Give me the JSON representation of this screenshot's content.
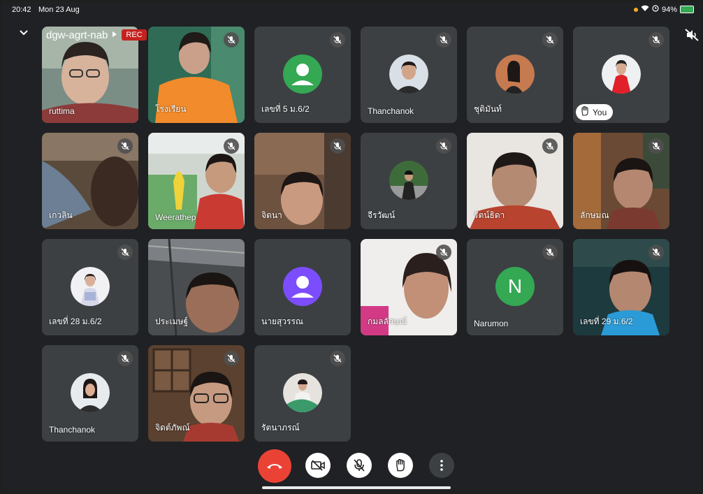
{
  "status": {
    "time": "20:42",
    "date": "Mon 23 Aug",
    "battery": "94%"
  },
  "meeting": {
    "code": "dgw-agrt-nab",
    "rec_label": "REC"
  },
  "tiles": [
    {
      "name": "ruttima"
    },
    {
      "name": "โรงเรียน"
    },
    {
      "name": "เลขที่ 5 ม.6/2"
    },
    {
      "name": "Thanchanok"
    },
    {
      "name": "ชุติมันท์"
    },
    {
      "name": "",
      "you_label": "You"
    },
    {
      "name": "เกวลิน"
    },
    {
      "name": "Weerathep"
    },
    {
      "name": "จิดนา"
    },
    {
      "name": "จีรวัฒน์"
    },
    {
      "name": "รัตน์ธิดา"
    },
    {
      "name": "ลักษมณ"
    },
    {
      "name": "เลขที่ 28 ม.6/2"
    },
    {
      "name": "ประเมษฐ์"
    },
    {
      "name": "นายสุวรรณ"
    },
    {
      "name": "กมลลักษณ์"
    },
    {
      "name": "Narumon",
      "initial": "N"
    },
    {
      "name": "เลขที่ 29 ม.6/2"
    },
    {
      "name": "Thanchanok"
    },
    {
      "name": "จิดต์ภัพณ์"
    },
    {
      "name": "รัตนาภรณ์"
    }
  ],
  "colors": {
    "accent": "#8ab4f8",
    "end_call": "#ea4335",
    "rec": "#c5221f",
    "avatar_green": "#34a853",
    "avatar_purple": "#7c4dff",
    "narumon_green": "#34a853"
  }
}
